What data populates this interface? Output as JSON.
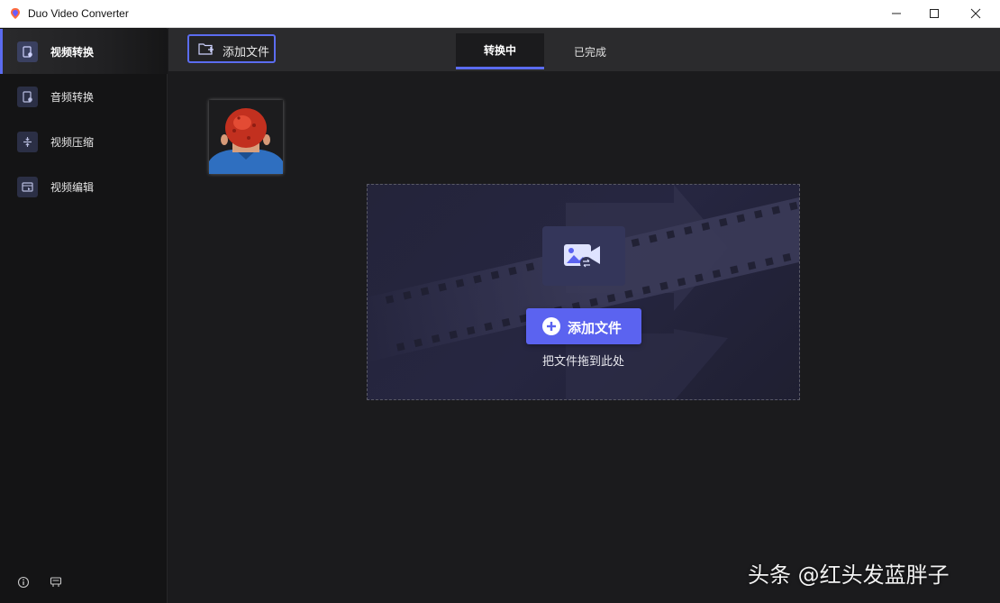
{
  "window": {
    "title": "Duo Video Converter",
    "controls": [
      "minimize",
      "maximize",
      "close"
    ]
  },
  "sidebar": {
    "items": [
      {
        "label": "视频转换",
        "icon": "video-convert-icon",
        "active": true
      },
      {
        "label": "音频转换",
        "icon": "audio-convert-icon",
        "active": false
      },
      {
        "label": "视频压缩",
        "icon": "compress-icon",
        "active": false
      },
      {
        "label": "视频编辑",
        "icon": "edit-icon",
        "active": false
      }
    ],
    "bottom_icons": [
      "info-icon",
      "feedback-icon"
    ]
  },
  "toolbar": {
    "add_file_label": "添加文件"
  },
  "tabs": [
    {
      "label": "转换中",
      "active": true
    },
    {
      "label": "已完成",
      "active": false
    }
  ],
  "dropzone": {
    "add_button_label": "添加文件",
    "hint": "把文件拖到此处"
  },
  "watermark": "头条 @红头发蓝胖子",
  "colors": {
    "accent": "#5b6cf0",
    "button": "#5b63f0",
    "background": "#1b1b1d",
    "sidebar": "#141415",
    "topbar": "#2b2b2d"
  }
}
